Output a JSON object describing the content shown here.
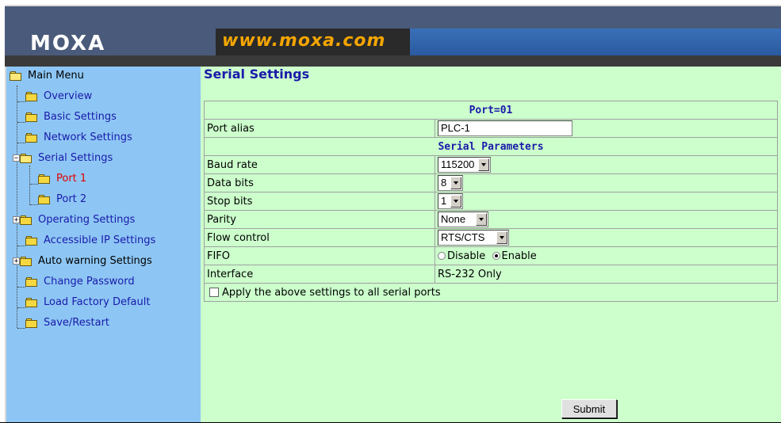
{
  "header": {
    "logo": "MOXA",
    "url": "www.moxa.com"
  },
  "menu": {
    "root": "Main Menu",
    "items": [
      {
        "label": "Overview"
      },
      {
        "label": "Basic Settings"
      },
      {
        "label": "Network Settings"
      },
      {
        "label": "Serial Settings",
        "expanded": true
      },
      {
        "label": "Port 1",
        "selected": true
      },
      {
        "label": "Port 2"
      },
      {
        "label": "Operating Settings",
        "expandable": true
      },
      {
        "label": "Accessible IP Settings"
      },
      {
        "label": "Auto warning Settings",
        "expandable": true
      },
      {
        "label": "Change Password"
      },
      {
        "label": "Load Factory Default"
      },
      {
        "label": "Save/Restart"
      }
    ]
  },
  "page": {
    "title": "Serial Settings",
    "port_header": "Port=01",
    "port_alias_label": "Port alias",
    "port_alias_value": "PLC-1",
    "serial_params_header": "Serial Parameters",
    "baud_rate_label": "Baud rate",
    "baud_rate_value": "115200",
    "data_bits_label": "Data bits",
    "data_bits_value": "8",
    "stop_bits_label": "Stop bits",
    "stop_bits_value": "1",
    "parity_label": "Parity",
    "parity_value": "None",
    "flow_control_label": "Flow control",
    "flow_control_value": "RTS/CTS",
    "fifo_label": "FIFO",
    "fifo_disable": "Disable",
    "fifo_enable": "Enable",
    "fifo_selected": "Enable",
    "interface_label": "Interface",
    "interface_value": "RS-232 Only",
    "apply_all_label": "Apply the above settings to all serial ports",
    "submit_label": "Submit"
  },
  "colors": {
    "sidebar_bg": "#8dc6f4",
    "main_bg": "#ccffcc",
    "link": "#1a1aaa",
    "selected": "#e00000",
    "url_text": "#f4a500"
  }
}
